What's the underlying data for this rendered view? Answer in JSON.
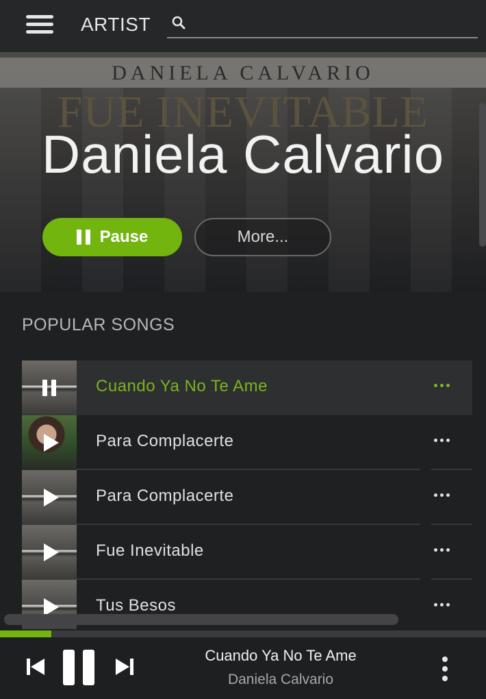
{
  "header": {
    "view_title": "ARTIST",
    "search": {
      "value": "",
      "placeholder": ""
    }
  },
  "hero": {
    "art_artist_text": "DANIELA CALVARIO",
    "art_album_text": "FUE INEVITABLE",
    "artist_name": "Daniela Calvario",
    "pause_label": "Pause",
    "more_label": "More..."
  },
  "popular": {
    "title": "POPULAR SONGS",
    "songs": [
      {
        "title": "Cuando Ya No Te Ame",
        "state": "playing",
        "art": "fue-inevitable-cover"
      },
      {
        "title": "Para Complacerte",
        "state": "idle",
        "art": "para-complacerte-cover"
      },
      {
        "title": "Para Complacerte",
        "state": "idle",
        "art": "fue-inevitable-cover"
      },
      {
        "title": "Fue Inevitable",
        "state": "idle",
        "art": "fue-inevitable-cover"
      },
      {
        "title": "Tus Besos",
        "state": "idle",
        "art": "fue-inevitable-cover"
      }
    ]
  },
  "player": {
    "track_title": "Cuando Ya No Te Ame",
    "track_artist": "Daniela Calvario",
    "progress_fraction": 0.105
  },
  "colors": {
    "accent": "#72b50f",
    "active_text": "#7ab51d",
    "background": "#1f2022"
  }
}
